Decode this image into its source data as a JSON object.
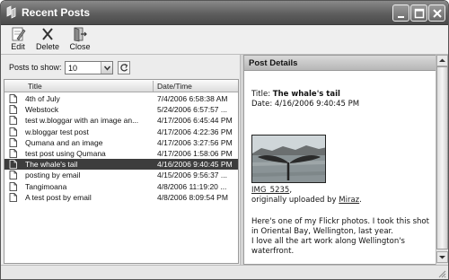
{
  "window": {
    "title": "Recent Posts"
  },
  "toolbar": {
    "edit_label": "Edit",
    "delete_label": "Delete",
    "close_label": "Close"
  },
  "filter": {
    "label": "Posts to show:",
    "value": "10"
  },
  "list": {
    "columns": [
      "Title",
      "Date/Time"
    ],
    "rows": [
      {
        "title": "4th of July",
        "datetime": "7/4/2006 6:58:38 AM"
      },
      {
        "title": "Webstock",
        "datetime": "5/24/2006 6:57:57 ..."
      },
      {
        "title": "test w.bloggar with an image an...",
        "datetime": "4/17/2006 6:45:44 PM"
      },
      {
        "title": "w.bloggar test post",
        "datetime": "4/17/2006 4:22:36 PM"
      },
      {
        "title": "Qumana and an image",
        "datetime": "4/17/2006 3:27:56 PM"
      },
      {
        "title": "test post using Qumana",
        "datetime": "4/17/2006 1:58:06 PM"
      },
      {
        "title": "The whale's tail",
        "datetime": "4/16/2006 9:40:45 PM",
        "selected": true
      },
      {
        "title": "posting by email",
        "datetime": "4/15/2006 9:56:37 ..."
      },
      {
        "title": "Tangimoana",
        "datetime": "4/8/2006 11:19:20 ..."
      },
      {
        "title": "A test post by email",
        "datetime": "4/8/2006 8:09:54 PM"
      }
    ]
  },
  "details": {
    "header": "Post Details",
    "title_label": "Title:",
    "title_value": "The whale's tail",
    "date_label": "Date:",
    "date_value": "4/16/2006 9:40:45 PM",
    "image_link": "IMG_5235",
    "caption_prefix": "originally uploaded by",
    "uploader": "Miraz",
    "body_line1": "Here's one of my Flickr photos. I took this shot in Oriental Bay, Wellington, last year.",
    "body_line2": "I love all the art work along Wellington's waterfront."
  },
  "colors": {
    "selection": "#3d3d3d",
    "titlebar": "#5e5e5e"
  }
}
